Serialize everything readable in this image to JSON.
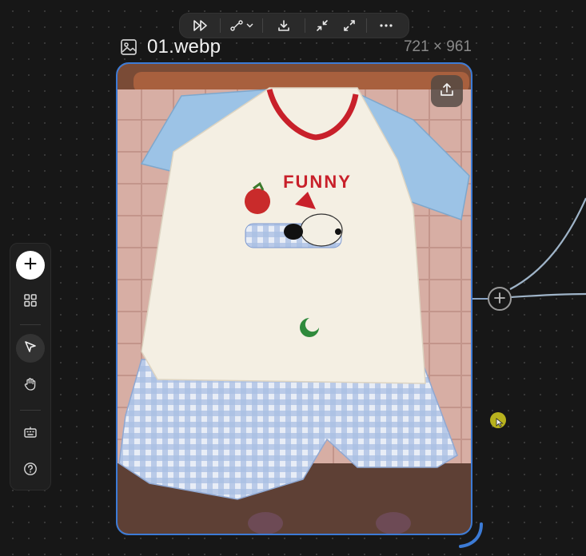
{
  "node": {
    "filename": "01.webp",
    "dimensions": "721 × 961"
  },
  "top_toolbar": {
    "buttons": [
      {
        "name": "fast-forward-icon"
      },
      {
        "name": "connect-path-icon"
      },
      {
        "name": "download-icon"
      },
      {
        "name": "collapse-icon"
      },
      {
        "name": "expand-icon"
      },
      {
        "name": "more-options-icon"
      }
    ]
  },
  "image": {
    "shirt_print_text": "FUNNY",
    "accent_color": "#3c7bd6"
  },
  "left_toolbar": {
    "tools": [
      {
        "name": "add-icon"
      },
      {
        "name": "grid-icon"
      },
      {
        "name": "select-pointer-icon",
        "active": true
      },
      {
        "name": "hand-pan-icon"
      },
      {
        "name": "keyboard-icon"
      },
      {
        "name": "help-icon"
      }
    ]
  }
}
